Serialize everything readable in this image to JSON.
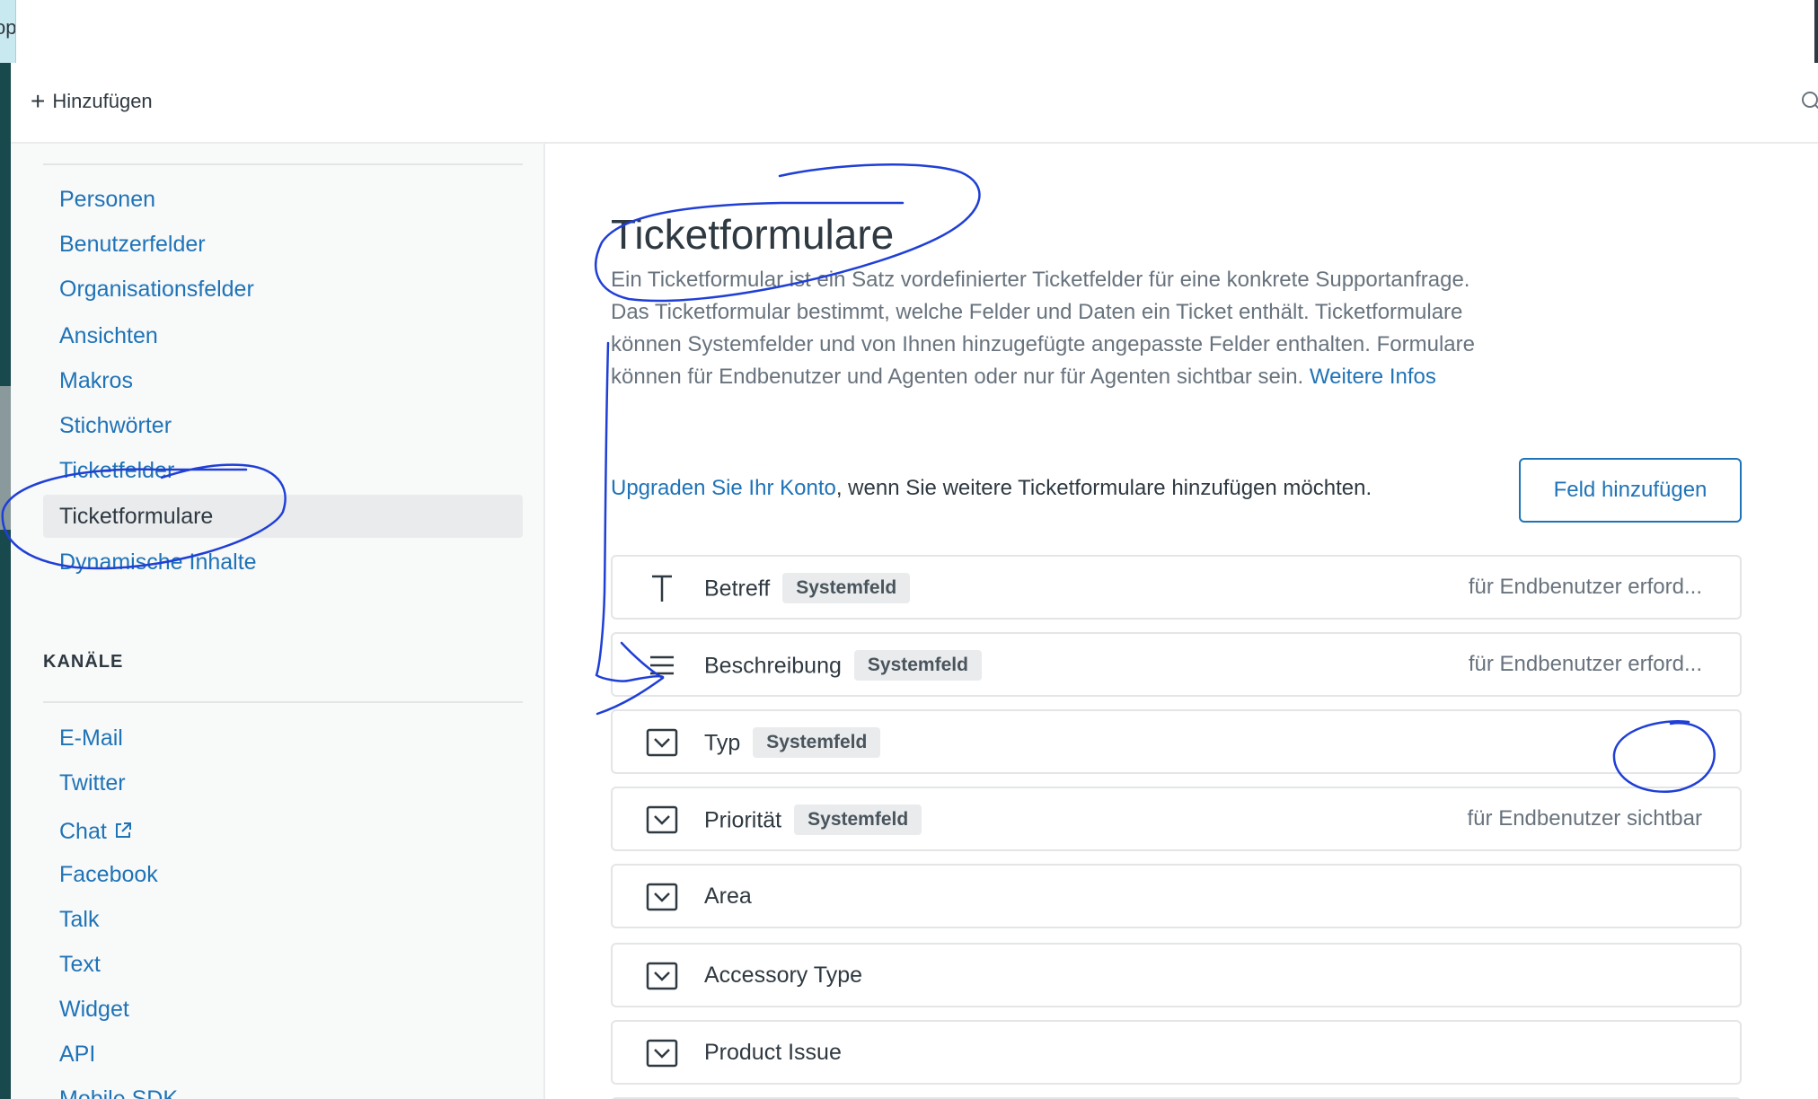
{
  "corner_tab_text": "op",
  "topbar": {
    "add_label": "Hinzufügen"
  },
  "sidebar": {
    "items": [
      {
        "label": "Personen"
      },
      {
        "label": "Benutzerfelder"
      },
      {
        "label": "Organisationsfelder"
      },
      {
        "label": "Ansichten"
      },
      {
        "label": "Makros"
      },
      {
        "label": "Stichwörter"
      },
      {
        "label": "Ticketfelder"
      },
      {
        "label": "Ticketformulare"
      },
      {
        "label": "Dynamische Inhalte"
      }
    ],
    "channels_title": "KANÄLE",
    "channels": [
      {
        "label": "E-Mail"
      },
      {
        "label": "Twitter"
      },
      {
        "label": "Chat"
      },
      {
        "label": "Facebook"
      },
      {
        "label": "Talk"
      },
      {
        "label": "Text"
      },
      {
        "label": "Widget"
      },
      {
        "label": "API"
      },
      {
        "label": "Mobile SDK"
      }
    ]
  },
  "main": {
    "title": "Ticketformulare",
    "description": "Ein Ticketformular ist ein Satz vordefinierter Ticketfelder für eine konkrete Supportanfrage. Das Ticketformular bestimmt, welche Felder und Daten ein Ticket enthält. Ticketformulare können Systemfelder und von Ihnen hinzugefügte angepasste Felder enthalten. Formulare können für Endbenutzer und Agenten oder nur für Agenten sichtbar sein.",
    "more_info_link": "Weitere Infos",
    "upgrade_link": "Upgraden Sie Ihr Konto",
    "upgrade_text": ", wenn Sie weitere Ticketformulare hinzufügen möchten.",
    "add_field_button": "Feld hinzufügen",
    "fields": [
      {
        "name": "Betreff",
        "badge": "Systemfeld",
        "status": "für Endbenutzer erford...",
        "icon": "text-field-icon"
      },
      {
        "name": "Beschreibung",
        "badge": "Systemfeld",
        "status": "für Endbenutzer erford...",
        "icon": "multiline-field-icon"
      },
      {
        "name": "Typ",
        "badge": "Systemfeld",
        "status": "",
        "icon": "dropdown-field-icon"
      },
      {
        "name": "Priorität",
        "badge": "Systemfeld",
        "status": "für Endbenutzer sichtbar",
        "icon": "dropdown-field-icon"
      },
      {
        "name": "Area",
        "badge": "",
        "status": "",
        "icon": "dropdown-field-icon"
      },
      {
        "name": "Accessory Type",
        "badge": "",
        "status": "",
        "icon": "dropdown-field-icon"
      },
      {
        "name": "Product Issue",
        "badge": "",
        "status": "",
        "icon": "dropdown-field-icon"
      }
    ]
  },
  "colors": {
    "accent": "#1f73b7",
    "annotation_ink": "#1f3fd6",
    "sidebar_bg": "#f8f9f9",
    "strip": "#17494d"
  }
}
